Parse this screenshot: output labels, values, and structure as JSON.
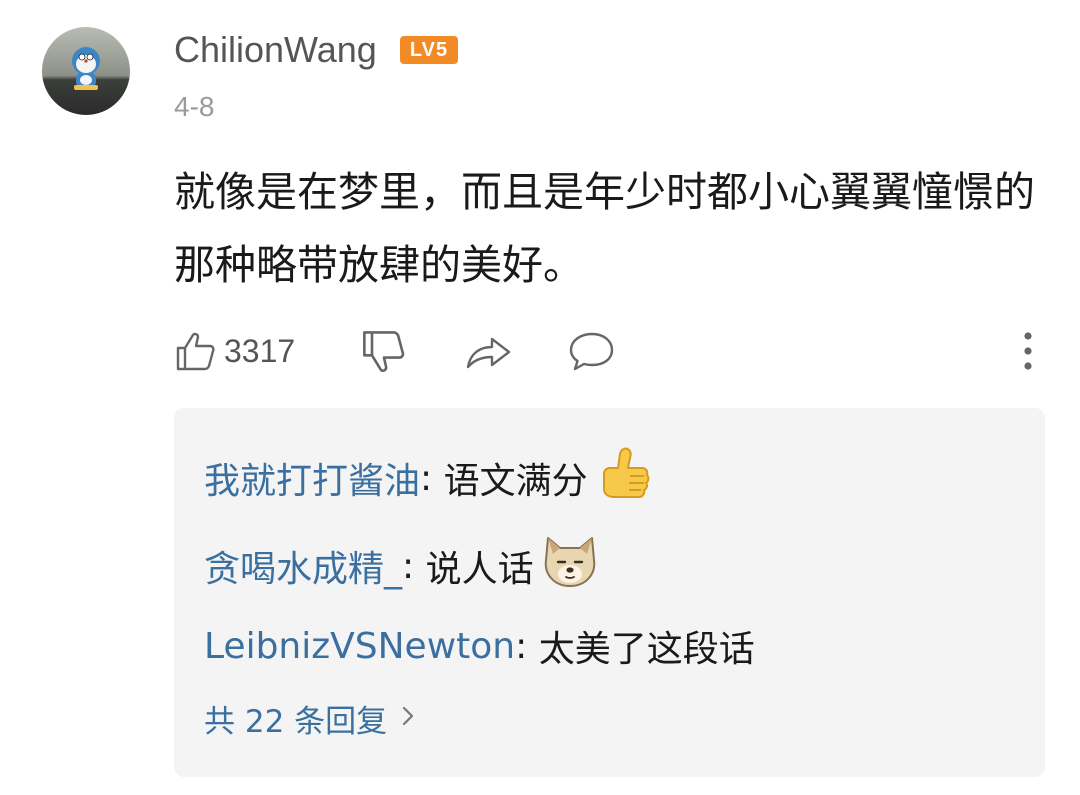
{
  "comment": {
    "username": "ChilionWang",
    "level_badge": "LV5",
    "date": "4-8",
    "text": "就像是在梦里，而且是年少时都小心翼翼憧憬的那种略带放肆的美好。"
  },
  "actions": {
    "like_count": "3317",
    "icons": [
      "thumbs-up-icon",
      "thumbs-down-icon",
      "share-icon",
      "comment-icon",
      "more-vertical-icon"
    ]
  },
  "replies": {
    "items": [
      {
        "name": "我就打打酱油",
        "separator": ": ",
        "text": "语文满分",
        "emoji": "thumbs-up-emoji"
      },
      {
        "name": "贪喝水成精_",
        "separator": ": ",
        "text": "说人话",
        "emoji": "dog-face-emoji"
      },
      {
        "name": "LeibnizVSNewton",
        "separator": ": ",
        "text": "太美了这段话",
        "emoji": ""
      }
    ],
    "more_label": "共 22 条回复"
  },
  "colors": {
    "link_blue": "#3a6f9f",
    "badge_orange": "#f28a25",
    "reply_bg": "#f4f4f5"
  }
}
